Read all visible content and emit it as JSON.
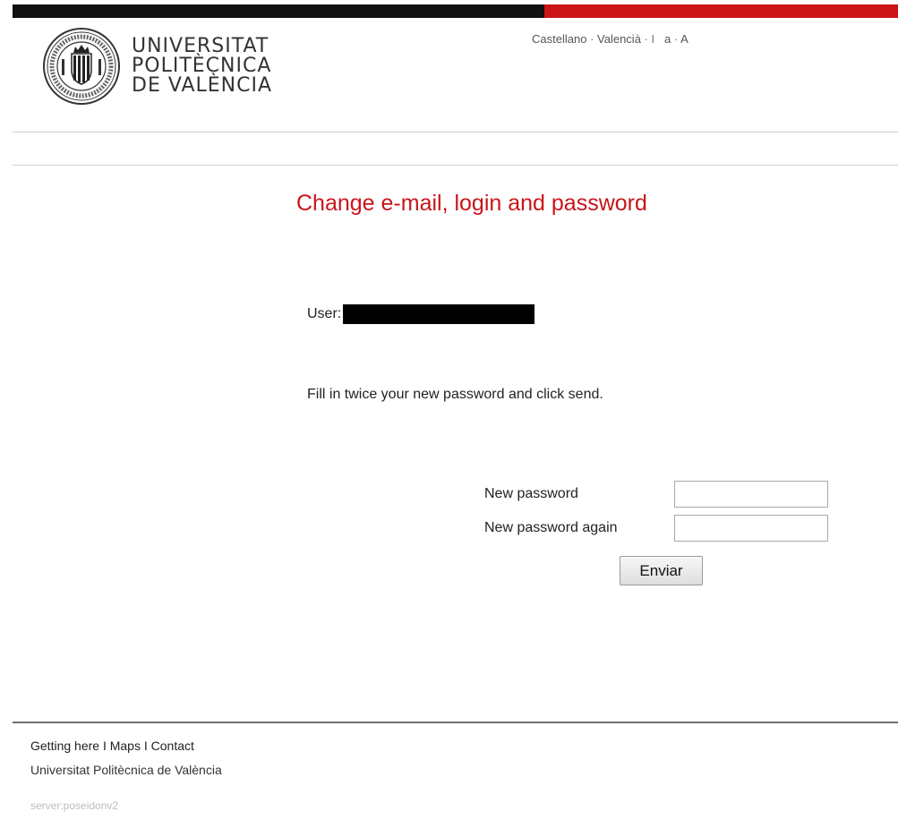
{
  "header": {
    "logo_lines": [
      "UNIVERSITAT",
      "POLITÈCNICA",
      "DE VALÈNCIA"
    ],
    "languages": [
      {
        "label": "Castellano"
      },
      {
        "label": "Valencià"
      }
    ],
    "text_size": {
      "separator": "I",
      "small": "a",
      "large": "A"
    }
  },
  "main": {
    "title": "Change e-mail, login and password",
    "user_label": "User:",
    "instructions": "Fill in twice your new password and click send.",
    "form": {
      "new_password_label": "New password",
      "new_password_value": "",
      "new_password_again_label": "New password again",
      "new_password_again_value": "",
      "submit_label": "Enviar"
    }
  },
  "footer": {
    "links": [
      "Getting here",
      "Maps",
      "Contact"
    ],
    "link_separator": "I",
    "organization": "Universitat Politècnica de València",
    "server": "server:poseidonv2"
  },
  "colors": {
    "accent_red": "#cc1417",
    "bar_black": "#111111"
  }
}
